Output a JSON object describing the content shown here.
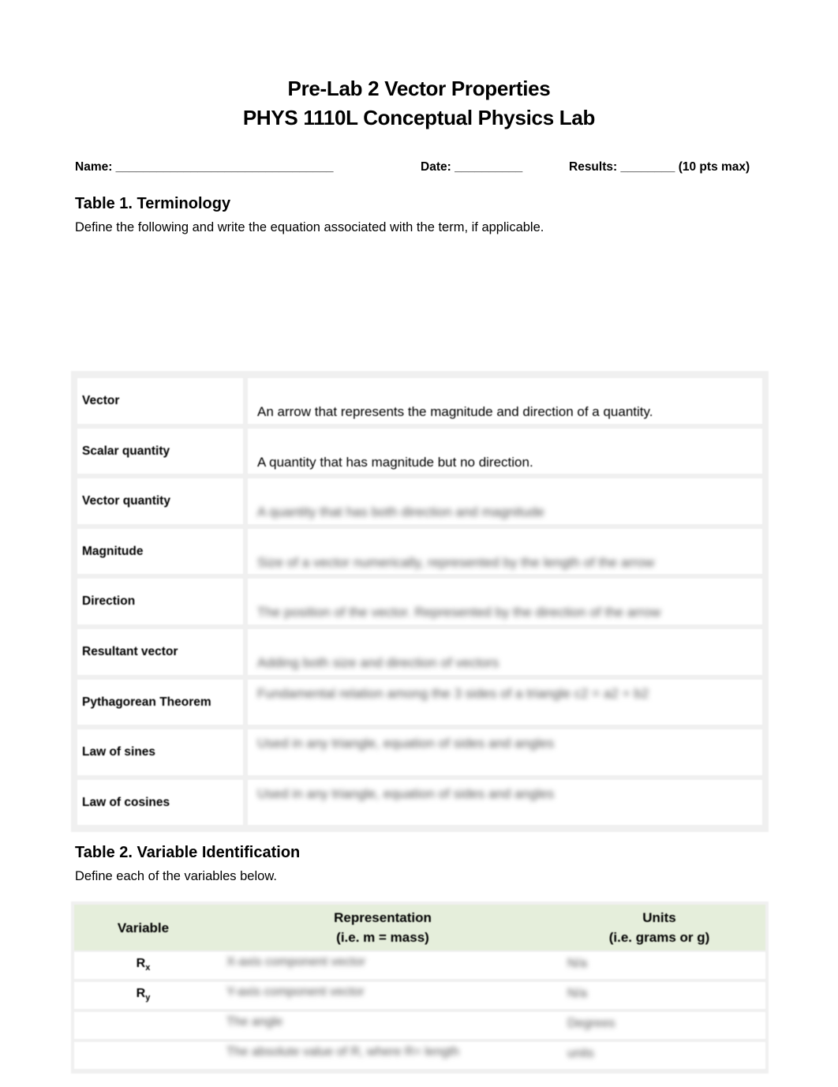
{
  "document": {
    "title_line1": "Pre-Lab 2 Vector Properties",
    "title_line2": "PHYS 1110L Conceptual Physics Lab"
  },
  "header_fields": {
    "name": "Name: ________________________________",
    "date": "Date: __________",
    "results": "Results: ________ (10 pts max)"
  },
  "table1": {
    "heading": "Table 1. Terminology",
    "instructions": "Define the following and write the equation associated with the term, if applicable.",
    "rows": [
      {
        "term": "Vector",
        "definition": "An arrow that represents the magnitude and direction of a quantity.",
        "blurred": false
      },
      {
        "term": "Scalar quantity",
        "definition": " A quantity that has magnitude but no direction.",
        "blurred": false
      },
      {
        "term": "Vector quantity",
        "definition": "A quantity that has both direction and magnitude",
        "blurred": true
      },
      {
        "term": "Magnitude",
        "definition": "Size of a vector numerically, represented by the length of the arrow",
        "blurred": true
      },
      {
        "term": "Direction",
        "definition": "The position of the vector. Represented by the direction of the arrow",
        "blurred": true
      },
      {
        "term": "Resultant vector",
        "definition": "Adding both size and direction of vectors",
        "blurred": true
      },
      {
        "term": "Pythagorean Theorem",
        "definition": "Fundamental relation among the 3 sides of a triangle c2 = a2 + b2",
        "blurred": true
      },
      {
        "term": "Law of sines",
        "definition": "Used in any triangle, equation of sides and angles",
        "blurred": true
      },
      {
        "term": "Law of cosines",
        "definition": "Used in any triangle, equation of sides and angles",
        "blurred": true
      }
    ]
  },
  "table2": {
    "heading": "Table 2. Variable Identification",
    "instructions": "Define each of the variables below.",
    "columns": {
      "variable": "Variable",
      "representation": "Representation\n(i.e. m = mass)",
      "units": "Units\n(i.e. grams or g)"
    },
    "rows": [
      {
        "variable": "R",
        "subscript": "x",
        "representation": "X-axis component vector",
        "units": "N/a"
      },
      {
        "variable": "R",
        "subscript": "y",
        "representation": "Y-axis component vector",
        "units": "N/a"
      },
      {
        "variable": "",
        "subscript": "",
        "representation": "The angle",
        "units": "Degrees"
      },
      {
        "variable": "",
        "subscript": "",
        "representation": "The absolute value of R, where R= length",
        "units": "units"
      }
    ]
  },
  "colors": {
    "table_header_bg": "#e5eedb",
    "table_border": "#f0f0f0"
  }
}
